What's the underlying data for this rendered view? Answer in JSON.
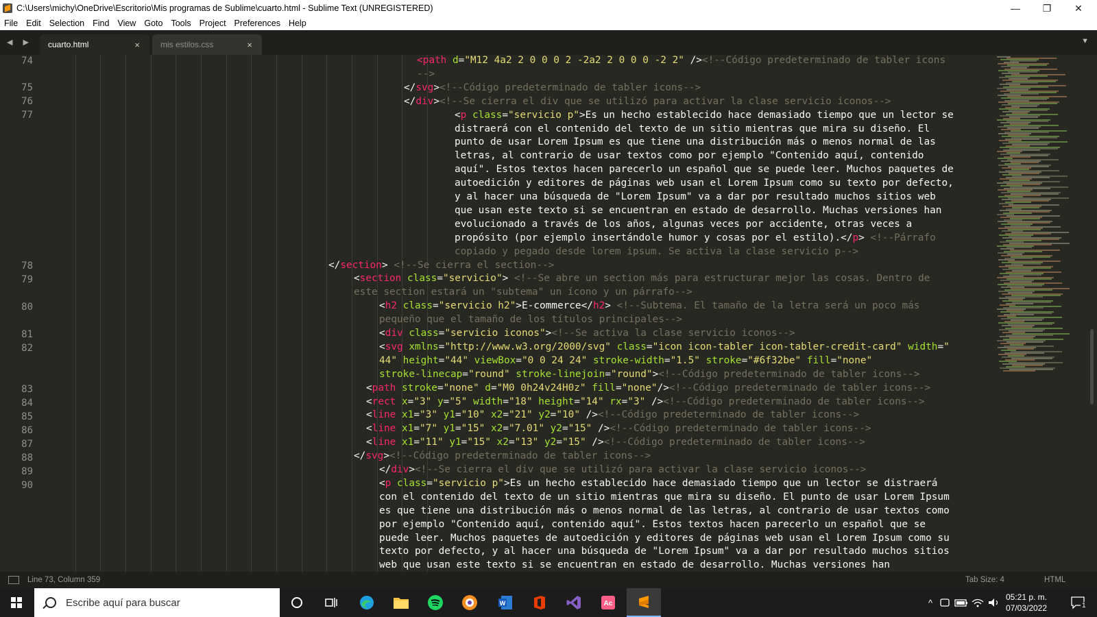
{
  "window": {
    "title": "C:\\Users\\michy\\OneDrive\\Escritorio\\Mis programas de Sublime\\cuarto.html - Sublime Text (UNREGISTERED)",
    "minimize_glyph": "—",
    "maximize_glyph": "❐",
    "close_glyph": "✕"
  },
  "menu": [
    "File",
    "Edit",
    "Selection",
    "Find",
    "View",
    "Goto",
    "Tools",
    "Project",
    "Preferences",
    "Help"
  ],
  "tabs": [
    {
      "label": "cuarto.html",
      "active": true
    },
    {
      "label": "mis estilos.css",
      "active": false
    }
  ],
  "tab_close_glyph": "×",
  "nav_arrows": "◀ ▶",
  "tab_menu_glyph": "▼",
  "line_numbers": [
    "74",
    "75",
    "76",
    "77",
    "78",
    "79",
    "80",
    "81",
    "82",
    "83",
    "84",
    "85",
    "86",
    "87",
    "88",
    "89",
    "90"
  ],
  "code_lines": [
    [
      [
        "t",
        "<path"
      ],
      [
        "a",
        " d"
      ],
      [
        "p",
        "="
      ],
      [
        "s",
        "\"M12 4a2 2 0 0 0 2 -2a2 2 0 0 0 -2 2\""
      ],
      [
        "p",
        " />"
      ],
      [
        "c",
        "<!--Código predeterminado de tabler icons"
      ]
    ],
    [
      [
        "c",
        "-->"
      ]
    ],
    [
      [
        "p",
        "</"
      ],
      [
        "t",
        "svg"
      ],
      [
        "p",
        ">"
      ],
      [
        "c",
        "<!--Código predeterminado de tabler icons-->"
      ]
    ],
    [
      [
        "p",
        "</"
      ],
      [
        "t",
        "div"
      ],
      [
        "p",
        ">"
      ],
      [
        "c",
        "<!--Se cierra el div que se utilizó para activar la clase servicio iconos-->"
      ]
    ],
    [
      [
        "p",
        "<"
      ],
      [
        "t",
        "p"
      ],
      [
        "a",
        " class"
      ],
      [
        "p",
        "="
      ],
      [
        "s",
        "\"servicio p\""
      ],
      [
        "p",
        ">Es un hecho establecido hace demasiado tiempo que un lector se"
      ]
    ],
    [
      [
        "p",
        "distraerá con el contenido del texto de un sitio mientras que mira su diseño. El"
      ]
    ],
    [
      [
        "p",
        "punto de usar Lorem Ipsum es que tiene una distribución más o menos normal de las"
      ]
    ],
    [
      [
        "p",
        "letras, al contrario de usar textos como por ejemplo \"Contenido aquí, contenido"
      ]
    ],
    [
      [
        "p",
        "aquí\". Estos textos hacen parecerlo un español que se puede leer. Muchos paquetes de"
      ]
    ],
    [
      [
        "p",
        "autoedición y editores de páginas web usan el Lorem Ipsum como su texto por defecto,"
      ]
    ],
    [
      [
        "p",
        "y al hacer una búsqueda de \"Lorem Ipsum\" va a dar por resultado muchos sitios web"
      ]
    ],
    [
      [
        "p",
        "que usan este texto si se encuentran en estado de desarrollo. Muchas versiones han"
      ]
    ],
    [
      [
        "p",
        "evolucionado a través de los años, algunas veces por accidente, otras veces a"
      ]
    ],
    [
      [
        "p",
        "propósito (por ejemplo insertándole humor y cosas por el estilo).</"
      ],
      [
        "t",
        "p"
      ],
      [
        "p",
        "> "
      ],
      [
        "c",
        "<!--Párrafo"
      ]
    ],
    [
      [
        "c",
        "copiado y pegado desde lorem ipsum. Se activa la clase servicio p-->"
      ]
    ],
    [
      [
        "p",
        "</"
      ],
      [
        "t",
        "section"
      ],
      [
        "p",
        "> "
      ],
      [
        "c",
        "<!--Se cierra el section-->"
      ]
    ],
    [
      [
        "p",
        "<"
      ],
      [
        "t",
        "section"
      ],
      [
        "a",
        " class"
      ],
      [
        "p",
        "="
      ],
      [
        "s",
        "\"servicio\""
      ],
      [
        "p",
        "> "
      ],
      [
        "c",
        "<!--Se abre un section más para estructurar mejor las cosas. Dentro de"
      ]
    ],
    [
      [
        "c",
        "este section estará un \"subtema\" un ícono y un párrafo-->"
      ]
    ],
    [
      [
        "p",
        "<"
      ],
      [
        "t",
        "h2"
      ],
      [
        "a",
        " class"
      ],
      [
        "p",
        "="
      ],
      [
        "s",
        "\"servicio h2\""
      ],
      [
        "p",
        ">E-commerce</"
      ],
      [
        "t",
        "h2"
      ],
      [
        "p",
        "> "
      ],
      [
        "c",
        "<!--Subtema. El tamaño de la letra será un poco más"
      ]
    ],
    [
      [
        "c",
        "pequeño que el tamaño de los títulos principales-->"
      ]
    ],
    [
      [
        "p",
        "<"
      ],
      [
        "t",
        "div"
      ],
      [
        "a",
        " class"
      ],
      [
        "p",
        "="
      ],
      [
        "s",
        "\"servicio iconos\""
      ],
      [
        "p",
        ">"
      ],
      [
        "c",
        "<!--Se activa la clase servicio iconos-->"
      ]
    ],
    [
      [
        "p",
        "<"
      ],
      [
        "t",
        "svg"
      ],
      [
        "a",
        " xmlns"
      ],
      [
        "p",
        "="
      ],
      [
        "s",
        "\"http://www.w3.org/2000/svg\""
      ],
      [
        "a",
        " class"
      ],
      [
        "p",
        "="
      ],
      [
        "s",
        "\"icon icon-tabler icon-tabler-credit-card\""
      ],
      [
        "a",
        " width"
      ],
      [
        "p",
        "="
      ],
      [
        "s",
        "\""
      ]
    ],
    [
      [
        "s",
        "44\""
      ],
      [
        "a",
        " height"
      ],
      [
        "p",
        "="
      ],
      [
        "s",
        "\"44\""
      ],
      [
        "a",
        " viewBox"
      ],
      [
        "p",
        "="
      ],
      [
        "s",
        "\"0 0 24 24\""
      ],
      [
        "a",
        " stroke-width"
      ],
      [
        "p",
        "="
      ],
      [
        "s",
        "\"1.5\""
      ],
      [
        "a",
        " stroke"
      ],
      [
        "p",
        "="
      ],
      [
        "s",
        "\"#6f32be\""
      ],
      [
        "a",
        " fill"
      ],
      [
        "p",
        "="
      ],
      [
        "s",
        "\"none\""
      ]
    ],
    [
      [
        "a",
        "stroke-linecap"
      ],
      [
        "p",
        "="
      ],
      [
        "s",
        "\"round\""
      ],
      [
        "a",
        " stroke-linejoin"
      ],
      [
        "p",
        "="
      ],
      [
        "s",
        "\"round\""
      ],
      [
        "p",
        ">"
      ],
      [
        "c",
        "<!--Código predeterminado de tabler icons-->"
      ]
    ],
    [
      [
        "p",
        "<"
      ],
      [
        "t",
        "path"
      ],
      [
        "a",
        " stroke"
      ],
      [
        "p",
        "="
      ],
      [
        "s",
        "\"none\""
      ],
      [
        "a",
        " d"
      ],
      [
        "p",
        "="
      ],
      [
        "s",
        "\"M0 0h24v24H0z\""
      ],
      [
        "a",
        " fill"
      ],
      [
        "p",
        "="
      ],
      [
        "s",
        "\"none\""
      ],
      [
        "p",
        "/>"
      ],
      [
        "c",
        "<!--Código predeterminado de tabler icons-->"
      ]
    ],
    [
      [
        "p",
        "<"
      ],
      [
        "t",
        "rect"
      ],
      [
        "a",
        " x"
      ],
      [
        "p",
        "="
      ],
      [
        "s",
        "\"3\""
      ],
      [
        "a",
        " y"
      ],
      [
        "p",
        "="
      ],
      [
        "s",
        "\"5\""
      ],
      [
        "a",
        " width"
      ],
      [
        "p",
        "="
      ],
      [
        "s",
        "\"18\""
      ],
      [
        "a",
        " height"
      ],
      [
        "p",
        "="
      ],
      [
        "s",
        "\"14\""
      ],
      [
        "a",
        " rx"
      ],
      [
        "p",
        "="
      ],
      [
        "s",
        "\"3\""
      ],
      [
        "p",
        " />"
      ],
      [
        "c",
        "<!--Código predeterminado de tabler icons-->"
      ]
    ],
    [
      [
        "p",
        "<"
      ],
      [
        "t",
        "line"
      ],
      [
        "a",
        " x1"
      ],
      [
        "p",
        "="
      ],
      [
        "s",
        "\"3\""
      ],
      [
        "a",
        " y1"
      ],
      [
        "p",
        "="
      ],
      [
        "s",
        "\"10\""
      ],
      [
        "a",
        " x2"
      ],
      [
        "p",
        "="
      ],
      [
        "s",
        "\"21\""
      ],
      [
        "a",
        " y2"
      ],
      [
        "p",
        "="
      ],
      [
        "s",
        "\"10\""
      ],
      [
        "p",
        " />"
      ],
      [
        "c",
        "<!--Código predeterminado de tabler icons-->"
      ]
    ],
    [
      [
        "p",
        "<"
      ],
      [
        "t",
        "line"
      ],
      [
        "a",
        " x1"
      ],
      [
        "p",
        "="
      ],
      [
        "s",
        "\"7\""
      ],
      [
        "a",
        " y1"
      ],
      [
        "p",
        "="
      ],
      [
        "s",
        "\"15\""
      ],
      [
        "a",
        " x2"
      ],
      [
        "p",
        "="
      ],
      [
        "s",
        "\"7.01\""
      ],
      [
        "a",
        " y2"
      ],
      [
        "p",
        "="
      ],
      [
        "s",
        "\"15\""
      ],
      [
        "p",
        " />"
      ],
      [
        "c",
        "<!--Código predeterminado de tabler icons-->"
      ]
    ],
    [
      [
        "p",
        "<"
      ],
      [
        "t",
        "line"
      ],
      [
        "a",
        " x1"
      ],
      [
        "p",
        "="
      ],
      [
        "s",
        "\"11\""
      ],
      [
        "a",
        " y1"
      ],
      [
        "p",
        "="
      ],
      [
        "s",
        "\"15\""
      ],
      [
        "a",
        " x2"
      ],
      [
        "p",
        "="
      ],
      [
        "s",
        "\"13\""
      ],
      [
        "a",
        " y2"
      ],
      [
        "p",
        "="
      ],
      [
        "s",
        "\"15\""
      ],
      [
        "p",
        " />"
      ],
      [
        "c",
        "<!--Código predeterminado de tabler icons-->"
      ]
    ],
    [
      [
        "p",
        "</"
      ],
      [
        "t",
        "svg"
      ],
      [
        "p",
        ">"
      ],
      [
        "c",
        "<!--Código predeterminado de tabler icons-->"
      ]
    ],
    [
      [
        "p",
        "</"
      ],
      [
        "t",
        "div"
      ],
      [
        "p",
        ">"
      ],
      [
        "c",
        "<!--Se cierra el div que se utilizó para activar la clase servicio iconos-->"
      ]
    ],
    [
      [
        "p",
        "<"
      ],
      [
        "t",
        "p"
      ],
      [
        "a",
        " class"
      ],
      [
        "p",
        "="
      ],
      [
        "s",
        "\"servicio p\""
      ],
      [
        "p",
        ">Es un hecho establecido hace demasiado tiempo que un lector se distraerá"
      ]
    ],
    [
      [
        "p",
        "con el contenido del texto de un sitio mientras que mira su diseño. El punto de usar Lorem Ipsum"
      ]
    ],
    [
      [
        "p",
        "es que tiene una distribución más o menos normal de las letras, al contrario de usar textos como"
      ]
    ],
    [
      [
        "p",
        "por ejemplo \"Contenido aquí, contenido aquí\". Estos textos hacen parecerlo un español que se"
      ]
    ],
    [
      [
        "p",
        "puede leer. Muchos paquetes de autoedición y editores de páginas web usan el Lorem Ipsum como su"
      ]
    ],
    [
      [
        "p",
        "texto por defecto, y al hacer una búsqueda de \"Lorem Ipsum\" va a dar por resultado muchos sitios"
      ]
    ],
    [
      [
        "p",
        "web que usan este texto si se encuentran en estado de desarrollo. Muchas versiones han"
      ]
    ]
  ],
  "status": {
    "position": "Line 73, Column 359",
    "tab_size": "Tab Size: 4",
    "syntax": "HTML"
  },
  "taskbar": {
    "search_placeholder": "Escribe aquí para buscar",
    "apps": [
      "cortana-icon",
      "task-view-icon",
      "edge-icon",
      "file-explorer-icon",
      "spotify-icon",
      "brave-icon",
      "word-icon",
      "office-icon",
      "visual-studio-icon",
      "acrobat-icon",
      "sublime-text-icon"
    ],
    "time": "05:21 p. m.",
    "date": "07/03/2022",
    "notification_count": "1"
  },
  "colors": {
    "background": "#272822",
    "tag": "#f92672",
    "attribute": "#a6e22e",
    "string": "#e6db74",
    "comment": "#75715e",
    "text": "#f8f8f2"
  }
}
